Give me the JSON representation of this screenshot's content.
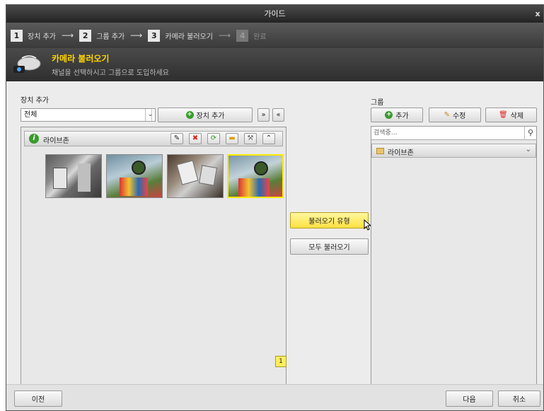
{
  "window": {
    "title": "가이드",
    "close_label": "x"
  },
  "steps": [
    {
      "num": "1",
      "label": "장치 추가"
    },
    {
      "num": "2",
      "label": "그룹 추가"
    },
    {
      "num": "3",
      "label": "카메라 불러오기"
    },
    {
      "num": "4",
      "label": "완료"
    }
  ],
  "header": {
    "title": "카메라 불러오기",
    "subtitle": "채널을 선택하시고 그룹으로 도입하세요"
  },
  "left": {
    "section_label": "장치 추가",
    "select_value": "전체",
    "add_device_label": "장치 추가",
    "live_label": "라이브존",
    "page": "1"
  },
  "middle": {
    "import_type_label": "불러오기 유형",
    "import_all_label": "모두 불러오기"
  },
  "right": {
    "section_label": "그룹",
    "add_label": "추가",
    "edit_label": "수정",
    "delete_label": "삭제",
    "search_placeholder": "검색중...",
    "group_name": "라이브존"
  },
  "footer": {
    "prev_label": "이전",
    "next_label": "다음",
    "cancel_label": "취소"
  }
}
